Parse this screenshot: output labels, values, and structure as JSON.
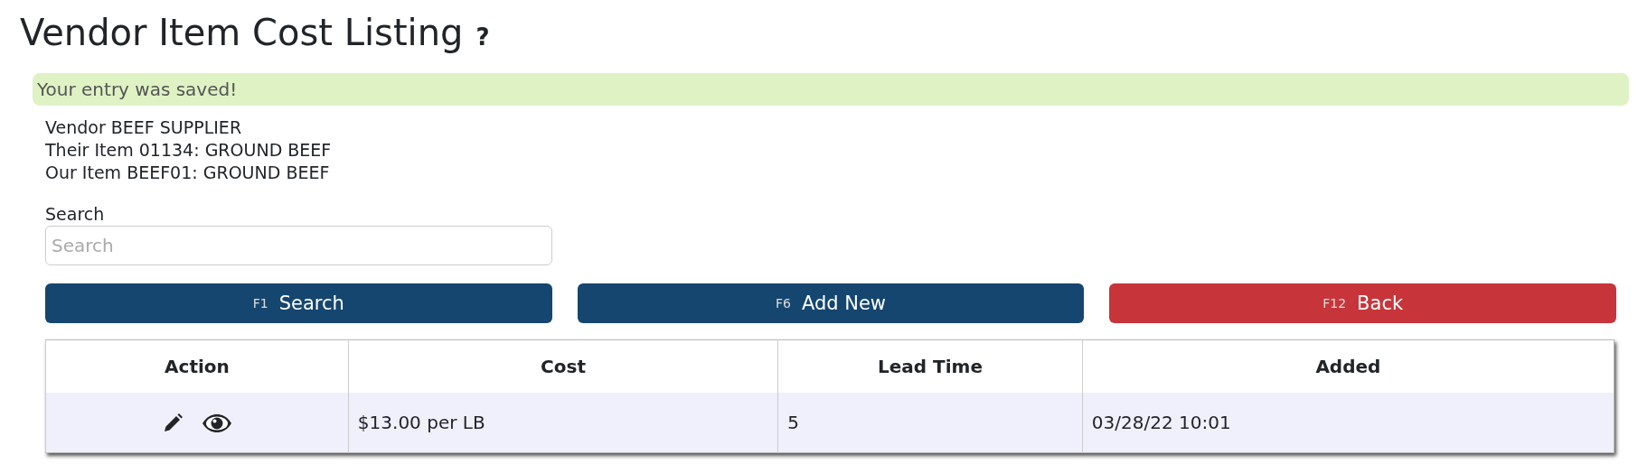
{
  "page": {
    "title": "Vendor Item Cost Listing",
    "help": "?"
  },
  "alert": {
    "message": "Your entry was saved!"
  },
  "details": [
    "Vendor BEEF SUPPLIER",
    "Their Item 01134: GROUND BEEF",
    "Our Item BEEF01: GROUND BEEF"
  ],
  "search": {
    "label": "Search",
    "placeholder": "Search"
  },
  "buttons": [
    {
      "key": "F1",
      "label": "Search",
      "kind": "primary"
    },
    {
      "key": "F6",
      "label": "Add New",
      "kind": "primary"
    },
    {
      "key": "F12",
      "label": "Back",
      "kind": "danger"
    }
  ],
  "table": {
    "columns": [
      "Action",
      "Cost",
      "Lead Time",
      "Added"
    ],
    "rows": [
      {
        "cost": "$13.00 per LB",
        "lead_time": "5",
        "added": "03/28/22 10:01"
      }
    ]
  }
}
